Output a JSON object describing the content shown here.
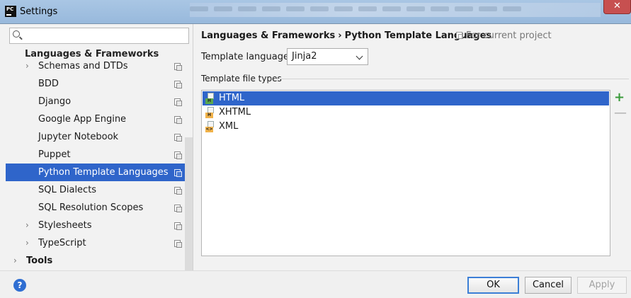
{
  "window": {
    "title": "Settings",
    "app_icon_text": "PC",
    "close_glyph": "✕"
  },
  "sidebar": {
    "group_title": "Languages & Frameworks",
    "items": [
      {
        "label": "Schemas and DTDs",
        "arrow": "›",
        "level": "sub"
      },
      {
        "label": "BDD",
        "level": "child"
      },
      {
        "label": "Django",
        "level": "child"
      },
      {
        "label": "Google App Engine",
        "level": "child"
      },
      {
        "label": "Jupyter Notebook",
        "level": "child"
      },
      {
        "label": "Puppet",
        "level": "child"
      },
      {
        "label": "Python Template Languages",
        "level": "child",
        "selected": true
      },
      {
        "label": "SQL Dialects",
        "level": "child"
      },
      {
        "label": "SQL Resolution Scopes",
        "level": "child"
      },
      {
        "label": "Stylesheets",
        "arrow": "›",
        "level": "sub"
      },
      {
        "label": "TypeScript",
        "arrow": "›",
        "level": "sub"
      },
      {
        "label": "Tools",
        "arrow": "›",
        "level": "top"
      }
    ]
  },
  "main": {
    "breadcrumb_parent": "Languages & Frameworks",
    "breadcrumb_sep": "›",
    "breadcrumb_current": "Python Template Languages",
    "scope_label": "For current project",
    "template_language_label": "Template language:",
    "template_language_value": "Jinja2",
    "file_types_title": "Template file types",
    "file_types": [
      {
        "label": "HTML",
        "tag": "H",
        "tag_color": "#5aa84e",
        "selected": true
      },
      {
        "label": "XHTML",
        "tag": "H",
        "tag_color": "#f0b24a",
        "selected": false
      },
      {
        "label": "XML",
        "tag": "<>",
        "tag_color": "#f0b24a",
        "selected": false
      }
    ],
    "add_glyph": "+",
    "remove_glyph": "—"
  },
  "footer": {
    "help_glyph": "?",
    "ok_label": "OK",
    "cancel_label": "Cancel",
    "apply_label": "Apply"
  },
  "colors": {
    "selection": "#2f65ca",
    "add": "#3a9a3a"
  }
}
